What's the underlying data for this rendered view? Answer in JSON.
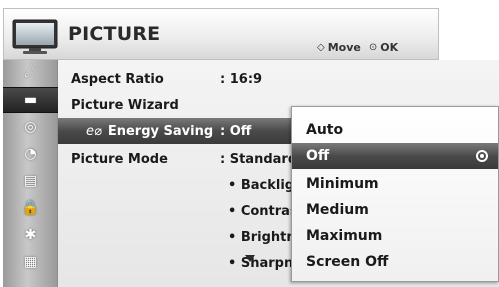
{
  "header": {
    "title": "PICTURE",
    "icon": "tv-icon",
    "hints": [
      {
        "icon": "move-arrows-icon",
        "glyph": "◇",
        "label": "Move"
      },
      {
        "icon": "ok-button-icon",
        "glyph": "⊙",
        "label": "OK"
      }
    ]
  },
  "sidebar": {
    "items": [
      {
        "icon": "satellite-dish-icon",
        "glyph": "☄"
      },
      {
        "icon": "picture-icon",
        "glyph": "▬",
        "selected": true
      },
      {
        "icon": "audio-icon",
        "glyph": "◎"
      },
      {
        "icon": "clock-icon",
        "glyph": "◔"
      },
      {
        "icon": "settings-list-icon",
        "glyph": "▤"
      },
      {
        "icon": "lock-icon",
        "glyph": "🔒"
      },
      {
        "icon": "bluetooth-icon",
        "glyph": "✱"
      },
      {
        "icon": "media-clapper-icon",
        "glyph": "▦"
      }
    ]
  },
  "menu": {
    "rows": [
      {
        "label": "Aspect Ratio",
        "value": ": 16:9"
      },
      {
        "label": "Picture Wizard",
        "value": ""
      },
      {
        "icon_glyph": "e⌀",
        "label": "Energy Saving",
        "value": ": Off",
        "highlighted": true
      },
      {
        "label": "Picture Mode",
        "value": ": Standard"
      },
      {
        "label": "",
        "value": "• Backlight"
      },
      {
        "label": "",
        "value": "• Contrast"
      },
      {
        "label": "",
        "value": "• Brightness"
      },
      {
        "label": "",
        "value": "• Sharpness"
      }
    ]
  },
  "dropdown": {
    "options": [
      {
        "label": "Auto"
      },
      {
        "label": "Off",
        "selected": true
      },
      {
        "label": "Minimum"
      },
      {
        "label": "Medium"
      },
      {
        "label": "Maximum"
      },
      {
        "label": "Screen Off"
      }
    ]
  },
  "colors": {
    "highlight": "#4a4a4a",
    "text": "#1a1a1a",
    "sidebar": "#b0b0b0"
  }
}
